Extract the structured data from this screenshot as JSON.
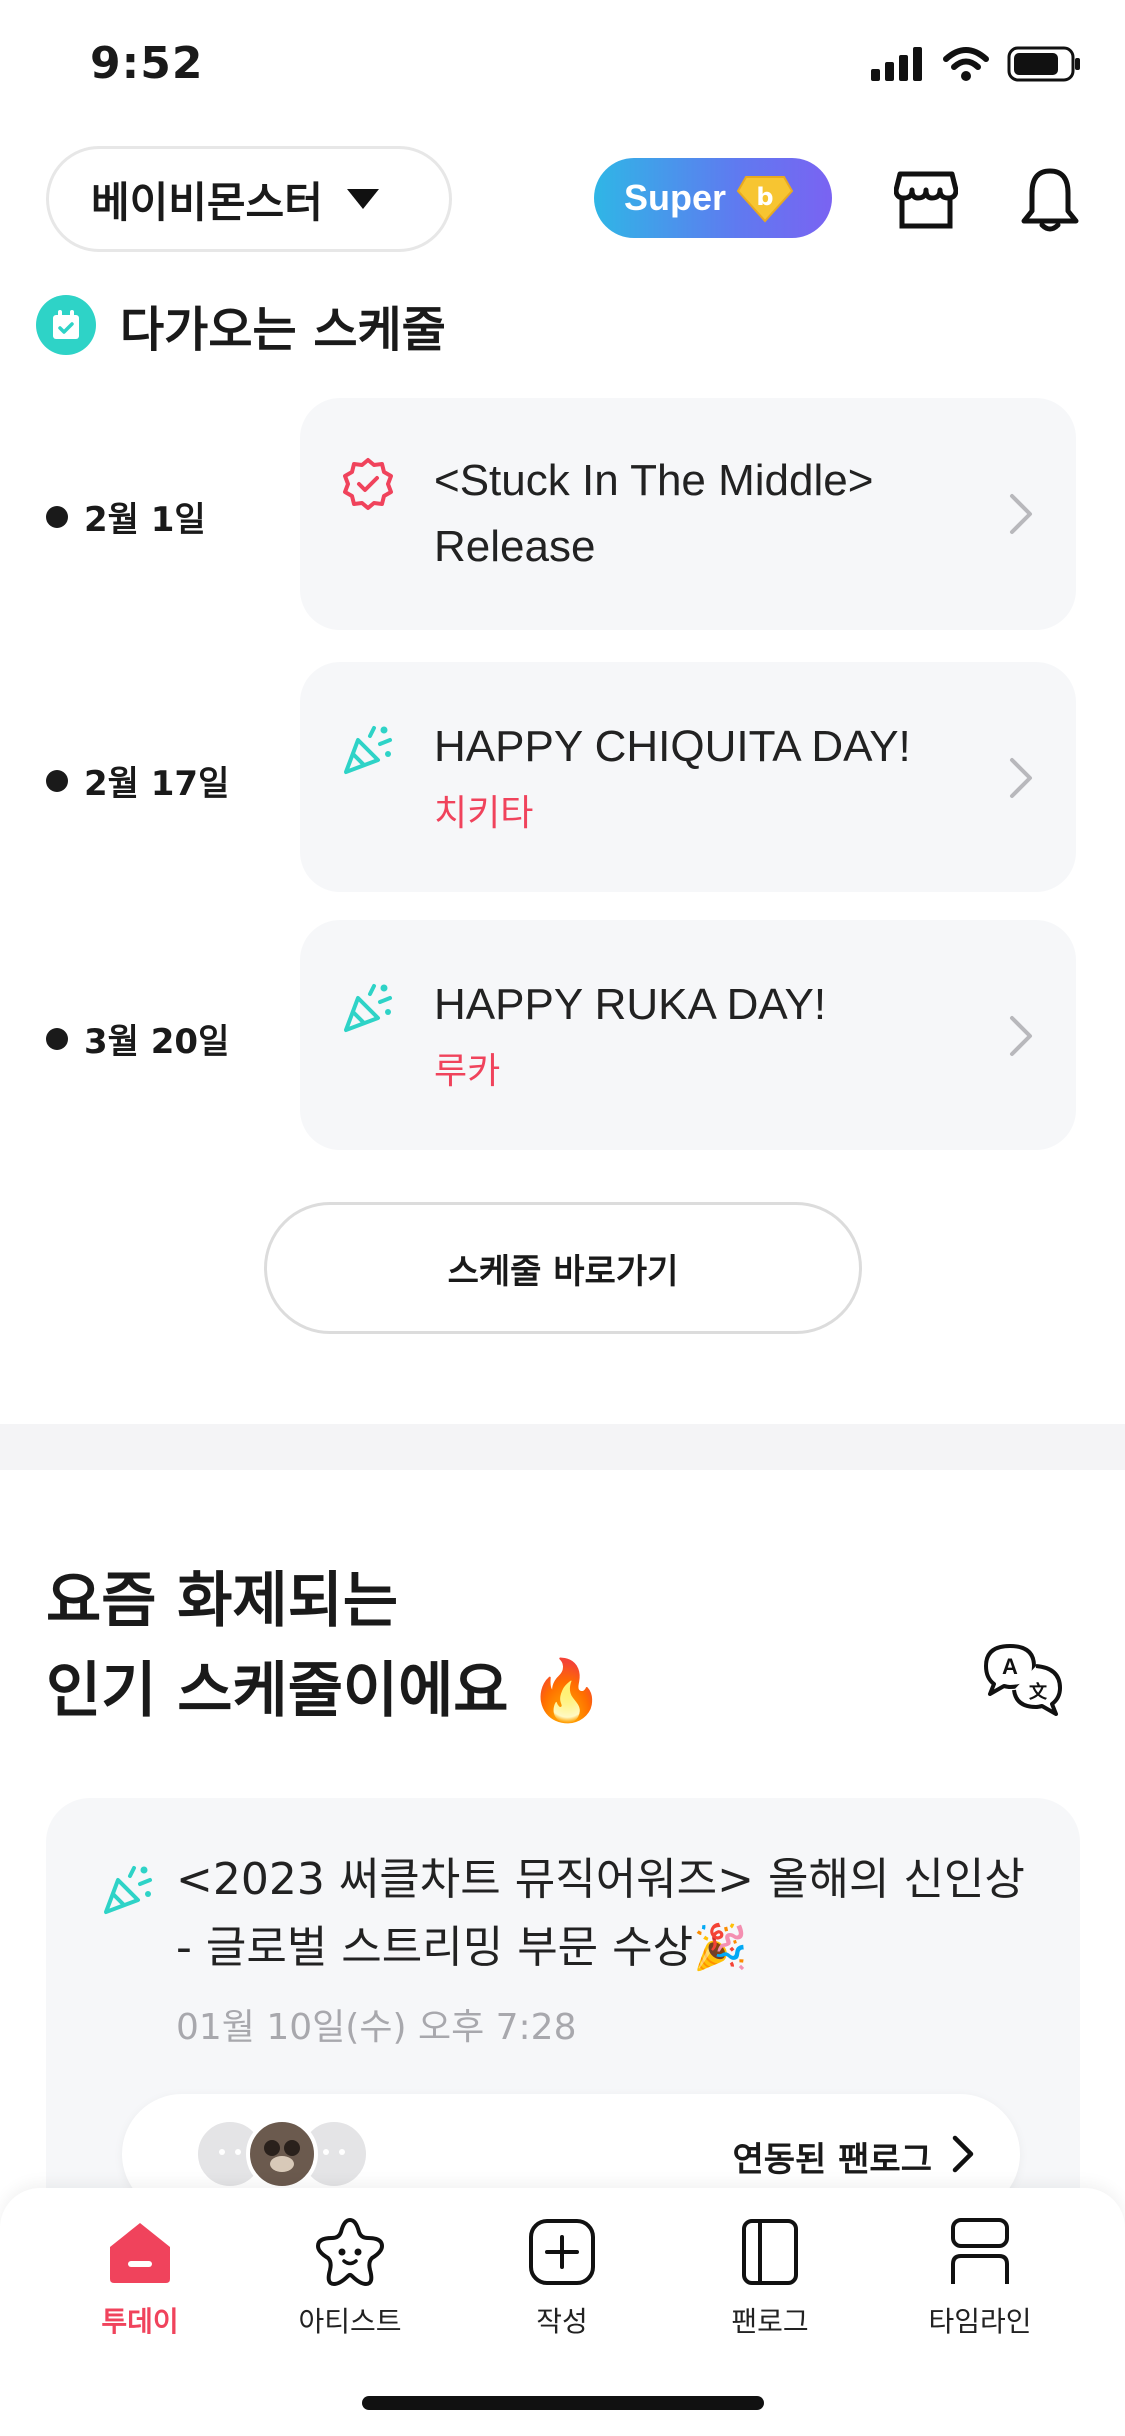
{
  "status": {
    "time": "9:52"
  },
  "header": {
    "artist_name": "베이비몬스터",
    "super_label": "Super",
    "icons": [
      "dropdown-arrow-icon",
      "shop-icon",
      "bell-icon"
    ]
  },
  "upcoming": {
    "title": "다가오는 스케줄",
    "items": [
      {
        "date": "2월 1일",
        "title_line1": "<Stuck In The Middle>",
        "title_line2": "Release",
        "subtitle": "",
        "icon": "verified-badge-icon"
      },
      {
        "date": "2월 17일",
        "title_line1": "HAPPY CHIQUITA DAY!",
        "title_line2": "",
        "subtitle": "치키타",
        "icon": "party-popper-icon"
      },
      {
        "date": "3월 20일",
        "title_line1": "HAPPY RUKA DAY!",
        "title_line2": "",
        "subtitle": "루카",
        "icon": "party-popper-icon"
      }
    ],
    "button_label": "스케줄 바로가기"
  },
  "popular": {
    "title_line1": "요즘 화제되는",
    "title_line2": "인기 스케줄이에요 🔥",
    "card": {
      "title": "<2023 써클차트 뮤직어워즈> 올해의 신인상 - 글로벌 스트리밍 부문 수상🎉",
      "date": "01월 10일(수) 오후 7:28",
      "linked_label": "연동된 팬로그"
    }
  },
  "tabs": [
    {
      "label": "투데이",
      "icon": "home-icon",
      "active": true
    },
    {
      "label": "아티스트",
      "icon": "star-face-icon",
      "active": false
    },
    {
      "label": "작성",
      "icon": "plus-square-icon",
      "active": false
    },
    {
      "label": "팬로그",
      "icon": "notebook-icon",
      "active": false
    },
    {
      "label": "타임라인",
      "icon": "timeline-icon",
      "active": false
    }
  ],
  "colors": {
    "accent": "#f0435c",
    "teal": "#2ed3c7",
    "card_bg": "#f6f7f9"
  }
}
